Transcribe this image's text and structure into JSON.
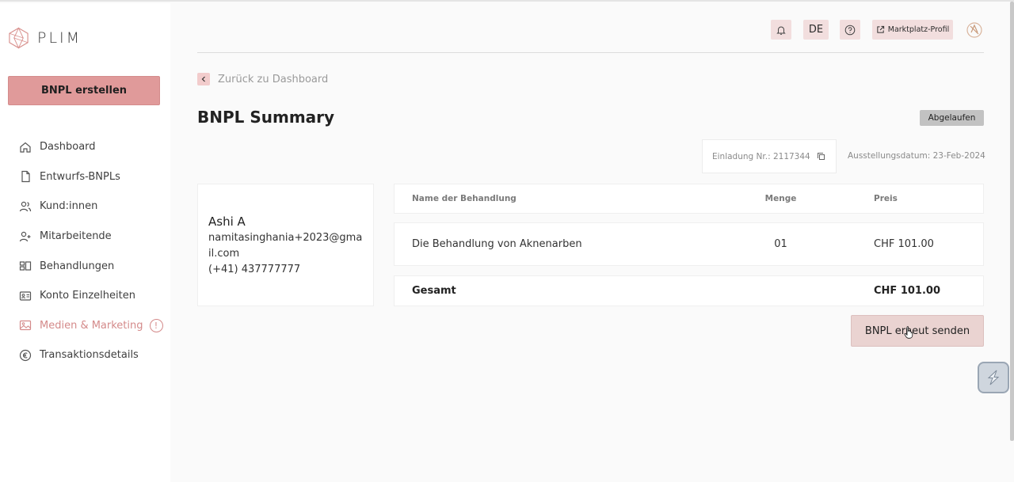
{
  "brand": {
    "name": "PLIM",
    "accent": "#e09a9a"
  },
  "sidebar": {
    "create_label": "BNPL erstellen",
    "items": [
      {
        "label": "Dashboard",
        "icon": "home-icon"
      },
      {
        "label": "Entwurfs-BNPLs",
        "icon": "document-icon"
      },
      {
        "label": "Kund:innen",
        "icon": "users-icon"
      },
      {
        "label": "Mitarbeitende",
        "icon": "user-plus-icon"
      },
      {
        "label": "Behandlungen",
        "icon": "treatment-icon"
      },
      {
        "label": "Konto Einzelheiten",
        "icon": "id-card-icon"
      },
      {
        "label": "Medien & Marketing",
        "icon": "image-icon",
        "active": true,
        "badge": "!"
      },
      {
        "label": "Transaktionsdetails",
        "icon": "euro-icon"
      }
    ]
  },
  "header": {
    "language": "DE",
    "marketplace_label": "Marktplatz-Profil"
  },
  "main": {
    "back_label": "Zurück zu Dashboard",
    "title": "BNPL Summary",
    "status": "Abgelaufen",
    "invite_label": "Einladung Nr.: 2117344",
    "issue_date": "Ausstellungsdatum: 23-Feb-2024",
    "customer": {
      "name": "Ashi A",
      "email": "namitasinghania+2023@gmail.com",
      "phone": "(+41) 437777777"
    },
    "table": {
      "headers": [
        "Name der Behandlung",
        "Menge",
        "Preis"
      ],
      "rows": [
        {
          "name": "Die Behandlung von Aknenarben",
          "qty": "01",
          "price": "CHF 101.00"
        }
      ],
      "total_label": "Gesamt",
      "total_value": "CHF 101.00"
    },
    "resend_label": "BNPL erneut senden"
  }
}
